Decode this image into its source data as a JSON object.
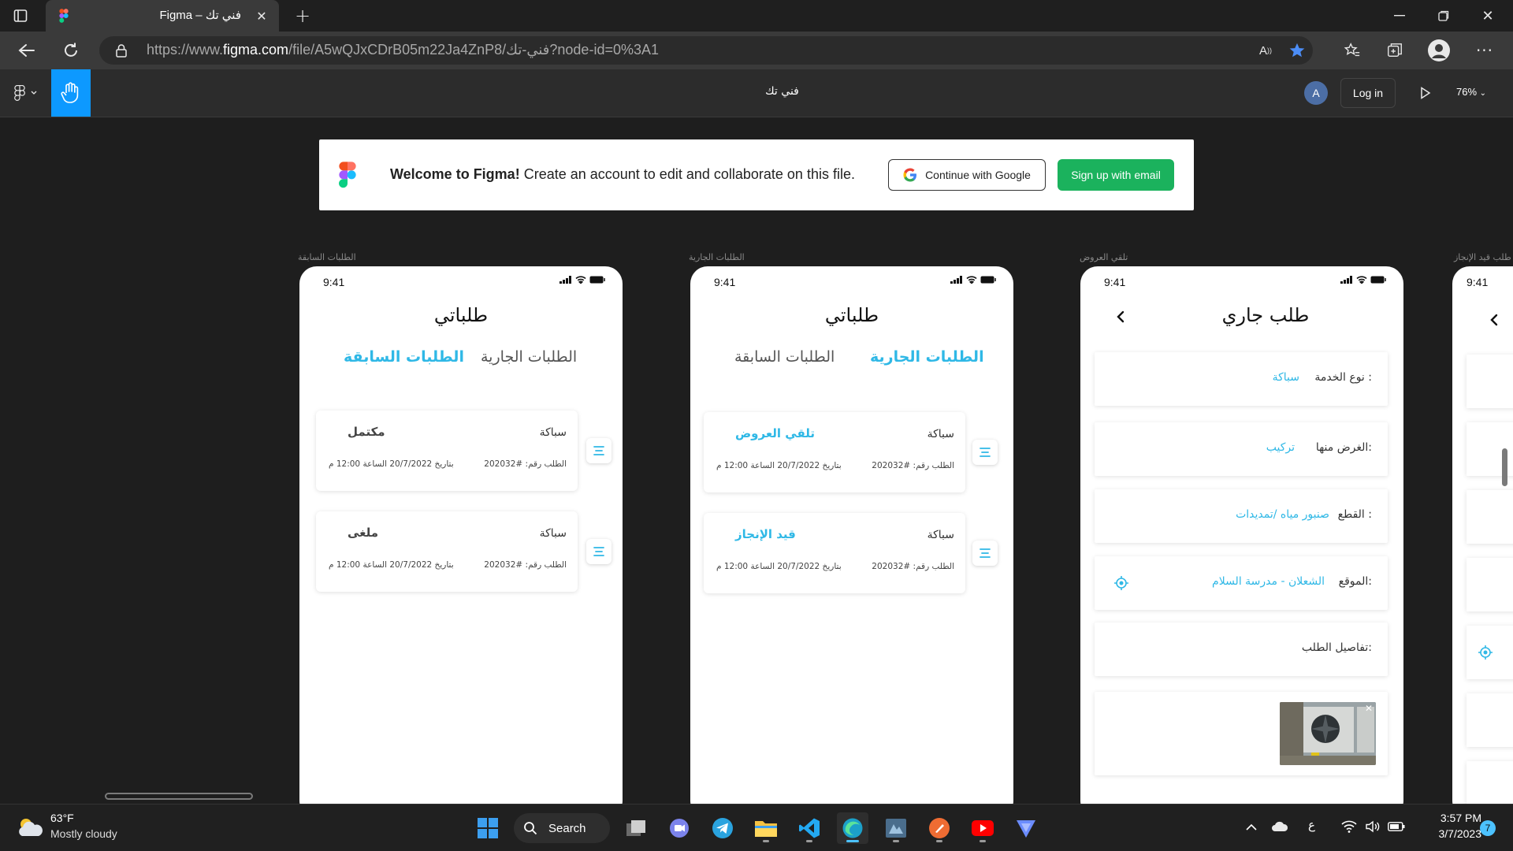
{
  "browser": {
    "tab_title": "Figma – فني تك",
    "url_prefix": "https://www.",
    "url_domain": "figma.com",
    "url_path": "/file/A5wQJxCDrB05m22Ja4ZnP8/فني-تك?node-id=0%3A1"
  },
  "figma": {
    "file_name": "فني تك",
    "avatar_letter": "A",
    "login_label": "Log in",
    "zoom": "76%"
  },
  "banner": {
    "welcome_bold": "Welcome to Figma!",
    "welcome_text": " Create an account to edit and collaborate on this file.",
    "google_btn": "Continue with Google",
    "email_btn": "Sign up with email"
  },
  "frames": [
    {
      "label": "الطلبات السابقة",
      "time": "9:41",
      "title": "طلباتي",
      "tab_active": "الطلبات السابقة",
      "tab_inactive": "الطلبات الجارية",
      "cards": [
        {
          "service": "سباكة",
          "status": "مكتمل",
          "order": "الطلب رقم: #202032",
          "date": "بتاريخ 20/7/2022  الساعة 12:00 م"
        },
        {
          "service": "سباكة",
          "status": "ملغى",
          "order": "الطلب رقم: #202032",
          "date": "بتاريخ 20/7/2022  الساعة 12:00 م"
        }
      ]
    },
    {
      "label": "الطلبات الجارية",
      "time": "9:41",
      "title": "طلباتي",
      "tab_active": "الطلبات الجارية",
      "tab_inactive": "الطلبات السابقة",
      "cards": [
        {
          "service": "سباكة",
          "status": "تلقي العروض",
          "order": "الطلب رقم: #202032",
          "date": "بتاريخ 20/7/2022  الساعة 12:00 م"
        },
        {
          "service": "سباكة",
          "status": "قيد الإنجاز",
          "order": "الطلب رقم: #202032",
          "date": "بتاريخ 20/7/2022  الساعة 12:00 م"
        }
      ]
    },
    {
      "label": "تلقي العروض",
      "time": "9:41",
      "title": "طلب جاري",
      "fields": [
        {
          "label": "نوع الخدمة :",
          "value": "سباكة"
        },
        {
          "label": "الغرض منها:",
          "value": "تركيب"
        },
        {
          "label": "القطع :",
          "value": "صنبور مياه /تمديدات"
        },
        {
          "label": "الموقع:",
          "value": "الشعلان - مدرسة السلام"
        },
        {
          "label": "تفاصيل الطلب:",
          "value": ""
        }
      ]
    },
    {
      "label": "طلب قيد الإنجاز",
      "time": "9:41"
    }
  ],
  "colors": {
    "accent": "#2fb8e6",
    "figma_blue": "#0d99ff",
    "signup_green": "#1bb25d"
  },
  "taskbar": {
    "weather_temp": "63°F",
    "weather_desc": "Mostly cloudy",
    "search_label": "Search",
    "lang": "ع",
    "time": "3:57 PM",
    "date": "3/7/2023",
    "notif_count": "7"
  }
}
